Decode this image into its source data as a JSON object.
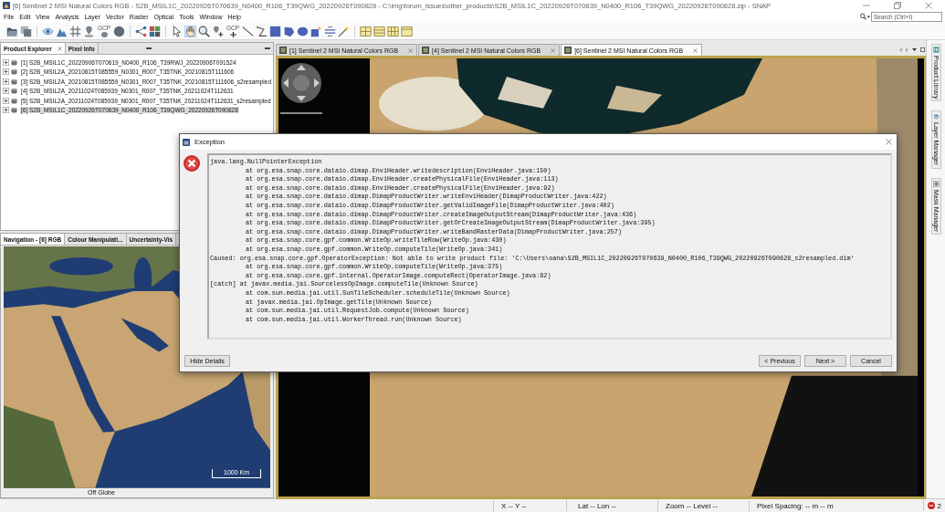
{
  "window": {
    "title": "[6] Sentinel 2 MSI Natural Colors RGB - S2B_MSIL1C_20220926T070639_N0400_R106_T39QWG_20220926T090828 - C:\\img\\forum_issues\\other_products\\S2B_MSIL1C_20220926T070639_N0400_R106_T39QWG_20220926T090828.zip - SNAP"
  },
  "menu": [
    "File",
    "Edit",
    "View",
    "Analysis",
    "Layer",
    "Vector",
    "Raster",
    "Optical",
    "Tools",
    "Window",
    "Help"
  ],
  "search": {
    "placeholder": "Search (Ctrl+I)"
  },
  "toolbar": {
    "tools": [
      {
        "selected": false
      },
      {
        "selected": false
      },
      {
        "selected": false
      },
      {
        "selected": false
      },
      {
        "selected": false
      },
      {
        "selected": false
      },
      {
        "selected": false,
        "label": "GCP"
      },
      {
        "selected": false
      },
      {
        "selected": false
      },
      {
        "selected": false
      },
      {
        "selected": false
      },
      {
        "selected": true
      },
      {
        "selected": false
      },
      {
        "selected": false
      },
      {
        "selected": false,
        "label": "GCP"
      },
      {
        "selected": false
      },
      {
        "selected": false
      },
      {
        "selected": false
      },
      {
        "selected": false
      },
      {
        "selected": false
      },
      {
        "selected": false
      },
      {
        "selected": false
      },
      {
        "selected": false
      },
      {
        "selected": false
      },
      {
        "selected": false
      },
      {
        "selected": false
      },
      {
        "selected": false
      }
    ]
  },
  "product_explorer": {
    "tabs": [
      {
        "label": "Product Explorer",
        "selected": true
      },
      {
        "label": "Pixel Info",
        "selected": false
      }
    ],
    "products": [
      {
        "label": "[1] S2B_MSIL1C_20220906T070619_N0400_R106_T39RWJ_20220906T091524",
        "selected": false,
        "expanded": false
      },
      {
        "label": "[2] S2B_MSIL2A_20210815T085559_N0301_R007_T35TNK_20210815T111606",
        "selected": false,
        "expanded": false
      },
      {
        "label": "[3] S2B_MSIL2A_20210815T085559_N0301_R007_T35TNK_20210815T111606_s2resampled",
        "selected": false,
        "expanded": false
      },
      {
        "label": "[4] S2B_MSIL2A_20211024T085939_N0301_R007_T35TNK_20211024T112631",
        "selected": false,
        "expanded": false
      },
      {
        "label": "[5] S2B_MSIL2A_20211024T085939_N0301_R007_T35TNK_20211024T112631_s2resampled",
        "selected": false,
        "expanded": false
      },
      {
        "label": "[6] S2B_MSIL1C_20220926T070639_N0400_R106_T39QWG_20220926T090828",
        "selected": true,
        "expanded": false
      }
    ]
  },
  "navigation": {
    "tabs": [
      {
        "label": "Navigation - [6] RGB",
        "selected": true
      },
      {
        "label": "Colour Manipulati...",
        "selected": false
      },
      {
        "label": "Uncertainty-Vis",
        "selected": false
      }
    ],
    "scale_bar": "1000 Km",
    "status": "Off Globe"
  },
  "image_tabs": [
    {
      "label": "[1] Sentinel 2 MSI Natural Colors RGB",
      "selected": false
    },
    {
      "label": "[4] Sentinel 2 MSI Natural Colors RGB",
      "selected": false
    },
    {
      "label": "[6] Sentinel 2 MSI Natural Colors RGB",
      "selected": true
    }
  ],
  "right_tabs": [
    "Product Library",
    "Layer Manager",
    "Mask Manager"
  ],
  "status_bar": {
    "position": "X -- Y --",
    "geo": "Lat -- Lon --",
    "zoom": "Zoom -- Level --",
    "pixel_spacing": "Pixel Spacing: -- m -- m",
    "notifications": "2"
  },
  "dialog": {
    "title": "Exception",
    "lines": [
      {
        "text": "java.lang.NullPointerException",
        "indented": false
      },
      {
        "text": "at org.esa.snap.core.dataio.dimap.EnviHeader.writedescription(EnviHeader.java:150)",
        "indented": true
      },
      {
        "text": "at org.esa.snap.core.dataio.dimap.EnviHeader.createPhysicalFile(EnviHeader.java:113)",
        "indented": true
      },
      {
        "text": "at org.esa.snap.core.dataio.dimap.EnviHeader.createPhysicalFile(EnviHeader.java:92)",
        "indented": true
      },
      {
        "text": "at org.esa.snap.core.dataio.dimap.DimapProductWriter.writeEnviHeader(DimapProductWriter.java:422)",
        "indented": true
      },
      {
        "text": "at org.esa.snap.core.dataio.dimap.DimapProductWriter.getValidImageFile(DimapProductWriter.java:402)",
        "indented": true
      },
      {
        "text": "at org.esa.snap.core.dataio.dimap.DimapProductWriter.createImageOutputStream(DimapProductWriter.java:436)",
        "indented": true
      },
      {
        "text": "at org.esa.snap.core.dataio.dimap.DimapProductWriter.getOrCreateImageOutputStream(DimapProductWriter.java:395)",
        "indented": true
      },
      {
        "text": "at org.esa.snap.core.dataio.dimap.DimapProductWriter.writeBandRasterData(DimapProductWriter.java:257)",
        "indented": true
      },
      {
        "text": "at org.esa.snap.core.gpf.common.WriteOp.writeTileRow(WriteOp.java:430)",
        "indented": true
      },
      {
        "text": "at org.esa.snap.core.gpf.common.WriteOp.computeTile(WriteOp.java:341)",
        "indented": true
      },
      {
        "text": "Caused: org.esa.snap.core.gpf.OperatorException: Not able to write product file: 'C:\\Users\\oana\\S2B_MSIL1C_20220926T070639_N0400_R106_T39QWG_20220926T090828_s2resampled.dim'",
        "indented": false
      },
      {
        "text": "at org.esa.snap.core.gpf.common.WriteOp.computeTile(WriteOp.java:375)",
        "indented": true
      },
      {
        "text": "at org.esa.snap.core.gpf.internal.OperatorImage.computeRect(OperatorImage.java:82)",
        "indented": true
      },
      {
        "text": "[catch] at javax.media.jai.SourcelessOpImage.computeTile(Unknown Source)",
        "indented": false
      },
      {
        "text": "at com.sun.media.jai.util.SunTileScheduler.scheduleTile(Unknown Source)",
        "indented": true
      },
      {
        "text": "at javax.media.jai.OpImage.getTile(Unknown Source)",
        "indented": true
      },
      {
        "text": "at com.sun.media.jai.util.RequestJob.compute(Unknown Source)",
        "indented": true
      },
      {
        "text": "at com.sun.media.jai.util.WorkerThread.run(Unknown Source)",
        "indented": true
      }
    ],
    "left_buttons": [
      "Hide Details"
    ],
    "buttons": [
      "< Previous",
      "Next >",
      "Cancel"
    ]
  }
}
